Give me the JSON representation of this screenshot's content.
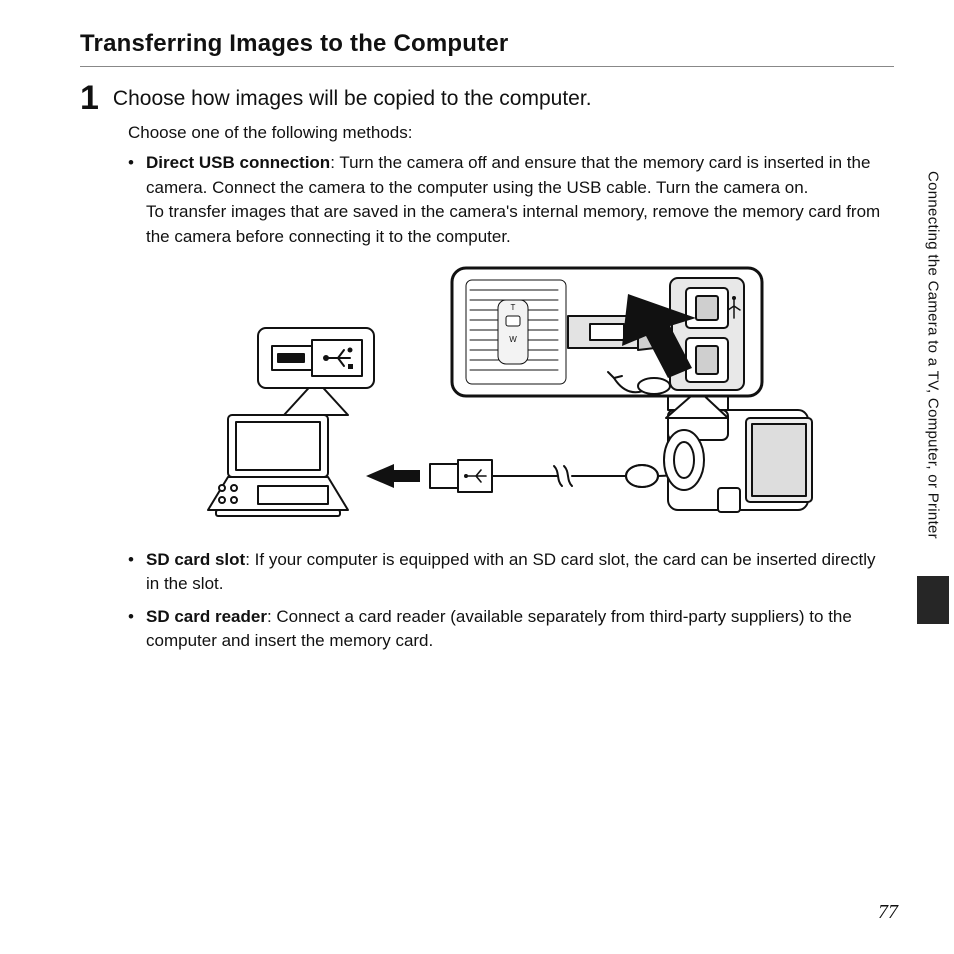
{
  "title": "Transferring Images to the Computer",
  "step": {
    "number": "1",
    "heading": "Choose how images will be copied to the computer."
  },
  "lead": "Choose one of the following methods:",
  "methods": {
    "usb": {
      "label": "Direct USB connection",
      "text": ": Turn the camera off and ensure that the memory card is inserted in the camera. Connect the camera to the computer using the USB cable. Turn the camera on.",
      "text2": "To transfer images that are saved in the camera's internal memory, remove the memory card from the camera before connecting it to the computer."
    },
    "slot": {
      "label": "SD card slot",
      "text": ": If your computer is equipped with an SD card slot, the card can be inserted directly in the slot."
    },
    "reader": {
      "label": "SD card reader",
      "text": ": Connect a card reader (available separately from third-party suppliers) to the computer and insert the memory card."
    }
  },
  "side_label": "Connecting the Camera to a TV, Computer, or Printer",
  "page_number": "77"
}
